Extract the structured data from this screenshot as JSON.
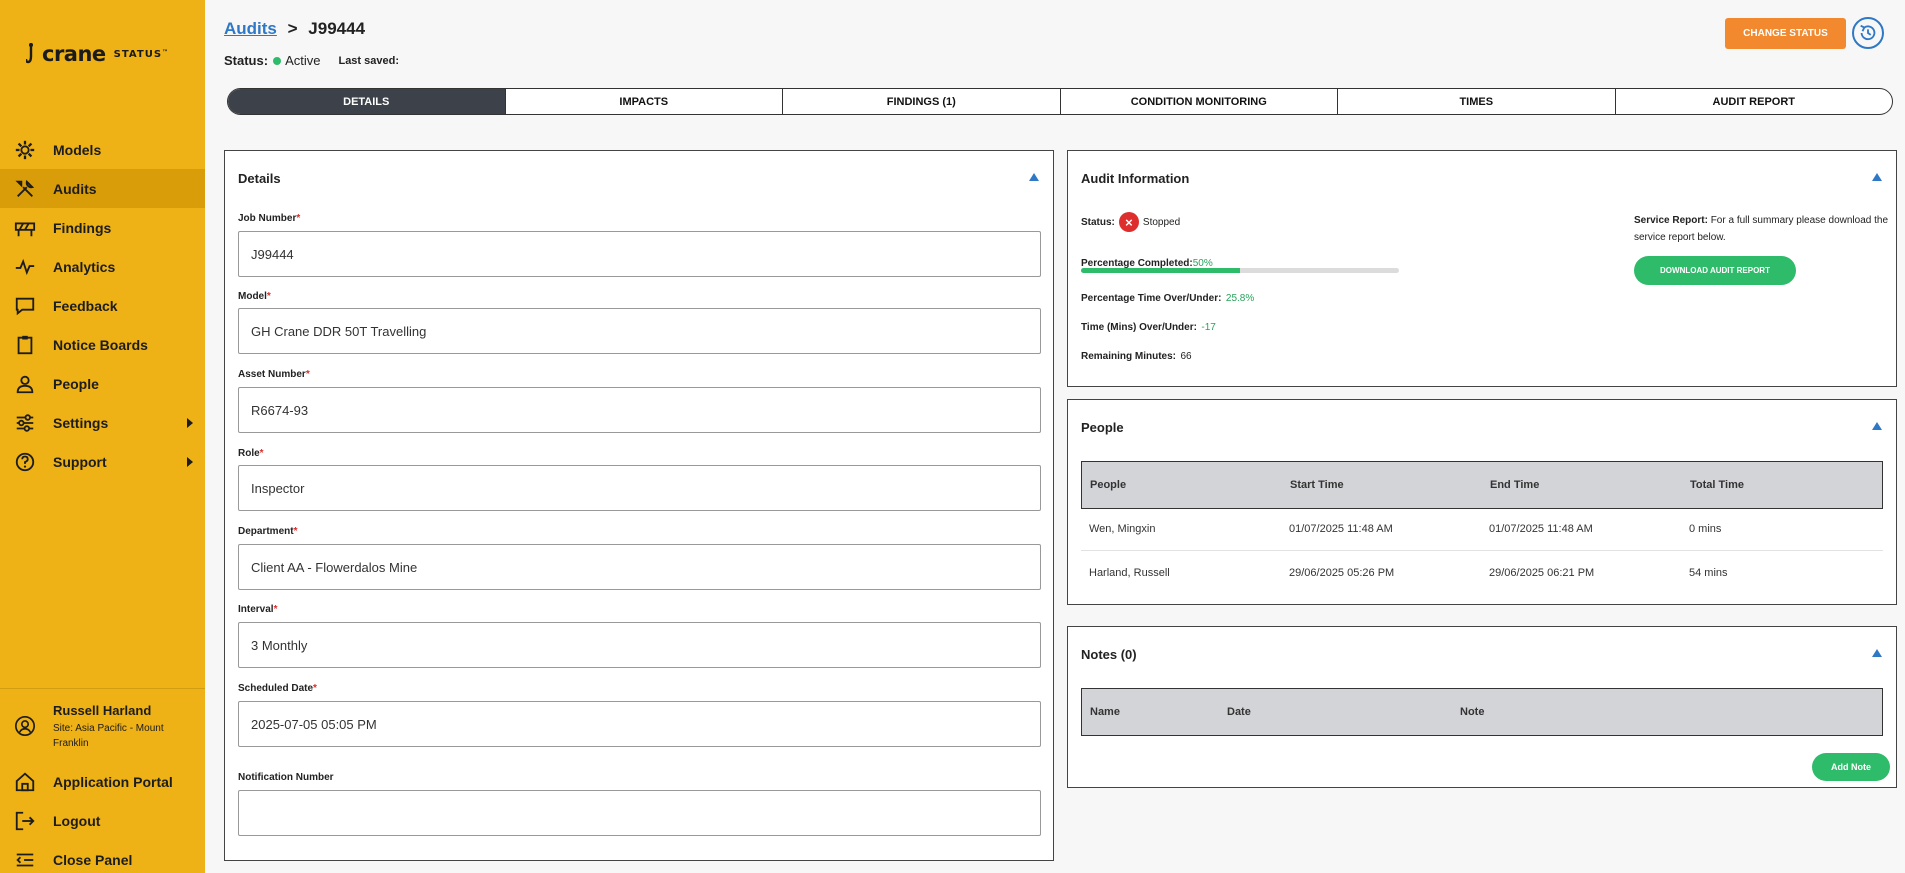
{
  "brand": {
    "name": "crane",
    "suffix": "STATUS",
    "tm": "™"
  },
  "sidebar": {
    "items": [
      {
        "label": "Models",
        "icon": "gear-icon"
      },
      {
        "label": "Audits",
        "icon": "tools-icon"
      },
      {
        "label": "Findings",
        "icon": "barrier-icon"
      },
      {
        "label": "Analytics",
        "icon": "pulse-icon"
      },
      {
        "label": "Feedback",
        "icon": "comment-icon"
      },
      {
        "label": "Notice Boards",
        "icon": "clipboard-icon"
      },
      {
        "label": "People",
        "icon": "person-icon"
      },
      {
        "label": "Settings",
        "icon": "sliders-icon"
      },
      {
        "label": "Support",
        "icon": "help-circle-icon"
      }
    ],
    "user": {
      "name": "Russell Harland",
      "site": "Site: Asia Pacific - Mount Franklin"
    },
    "bottom": [
      {
        "label": "Application Portal",
        "icon": "home-icon"
      },
      {
        "label": "Logout",
        "icon": "logout-icon"
      },
      {
        "label": "Close Panel",
        "icon": "collapse-menu-icon"
      }
    ]
  },
  "header": {
    "breadcrumb_parent": "Audits",
    "breadcrumb_sep": ">",
    "breadcrumb_current": "J99444",
    "status_label": "Status:",
    "status_value": "Active",
    "last_saved_label": "Last saved:",
    "change_status": "CHANGE STATUS",
    "accent": "#f2892e"
  },
  "tabs": [
    "DETAILS",
    "IMPACTS",
    "FINDINGS (1)",
    "CONDITION MONITORING",
    "TIMES",
    "AUDIT REPORT"
  ],
  "details": {
    "title": "Details",
    "fields": {
      "job_number": {
        "label": "Job Number",
        "value": "J99444"
      },
      "model": {
        "label": "Model",
        "value": "GH Crane DDR 50T Travelling"
      },
      "asset_number": {
        "label": "Asset Number",
        "value": "R6674-93"
      },
      "role": {
        "label": "Role",
        "value": "Inspector"
      },
      "department": {
        "label": "Department",
        "value": "Client AA - Flowerdalos Mine"
      },
      "interval": {
        "label": "Interval",
        "value": "3 Monthly"
      },
      "scheduled_date": {
        "label": "Scheduled Date",
        "value": "2025-07-05 05:05 PM"
      },
      "notification_number": {
        "label": "Notification Number",
        "value": ""
      }
    },
    "required_mark": "*"
  },
  "audit_info": {
    "title": "Audit Information",
    "status_label": "Status:",
    "status_value": "Stopped",
    "pct_completed_label": "Percentage Completed:",
    "pct_completed_value": "50%",
    "pct_completed_fraction": 0.5,
    "pct_time_label": "Percentage Time Over/Under:",
    "pct_time_value": "25.8%",
    "time_mins_label": "Time (Mins) Over/Under:",
    "time_mins_value": "-17",
    "remaining_label": "Remaining Minutes:",
    "remaining_value": "66",
    "service_report_label": "Service Report:",
    "service_report_text": "For a full summary please download the service report below.",
    "download_button": "DOWNLOAD AUDIT REPORT"
  },
  "people": {
    "title": "People",
    "columns": [
      "People",
      "Start Time",
      "End Time",
      "Total Time"
    ],
    "rows": [
      [
        "Wen, Mingxin",
        "01/07/2025 11:48 AM",
        "01/07/2025 11:48 AM",
        "0 mins"
      ],
      [
        "Harland, Russell",
        "29/06/2025 05:26 PM",
        "29/06/2025 06:21 PM",
        "54 mins"
      ]
    ]
  },
  "notes": {
    "title": "Notes (0)",
    "columns": [
      "Name",
      "Date",
      "Note"
    ],
    "add_button": "Add Note"
  }
}
